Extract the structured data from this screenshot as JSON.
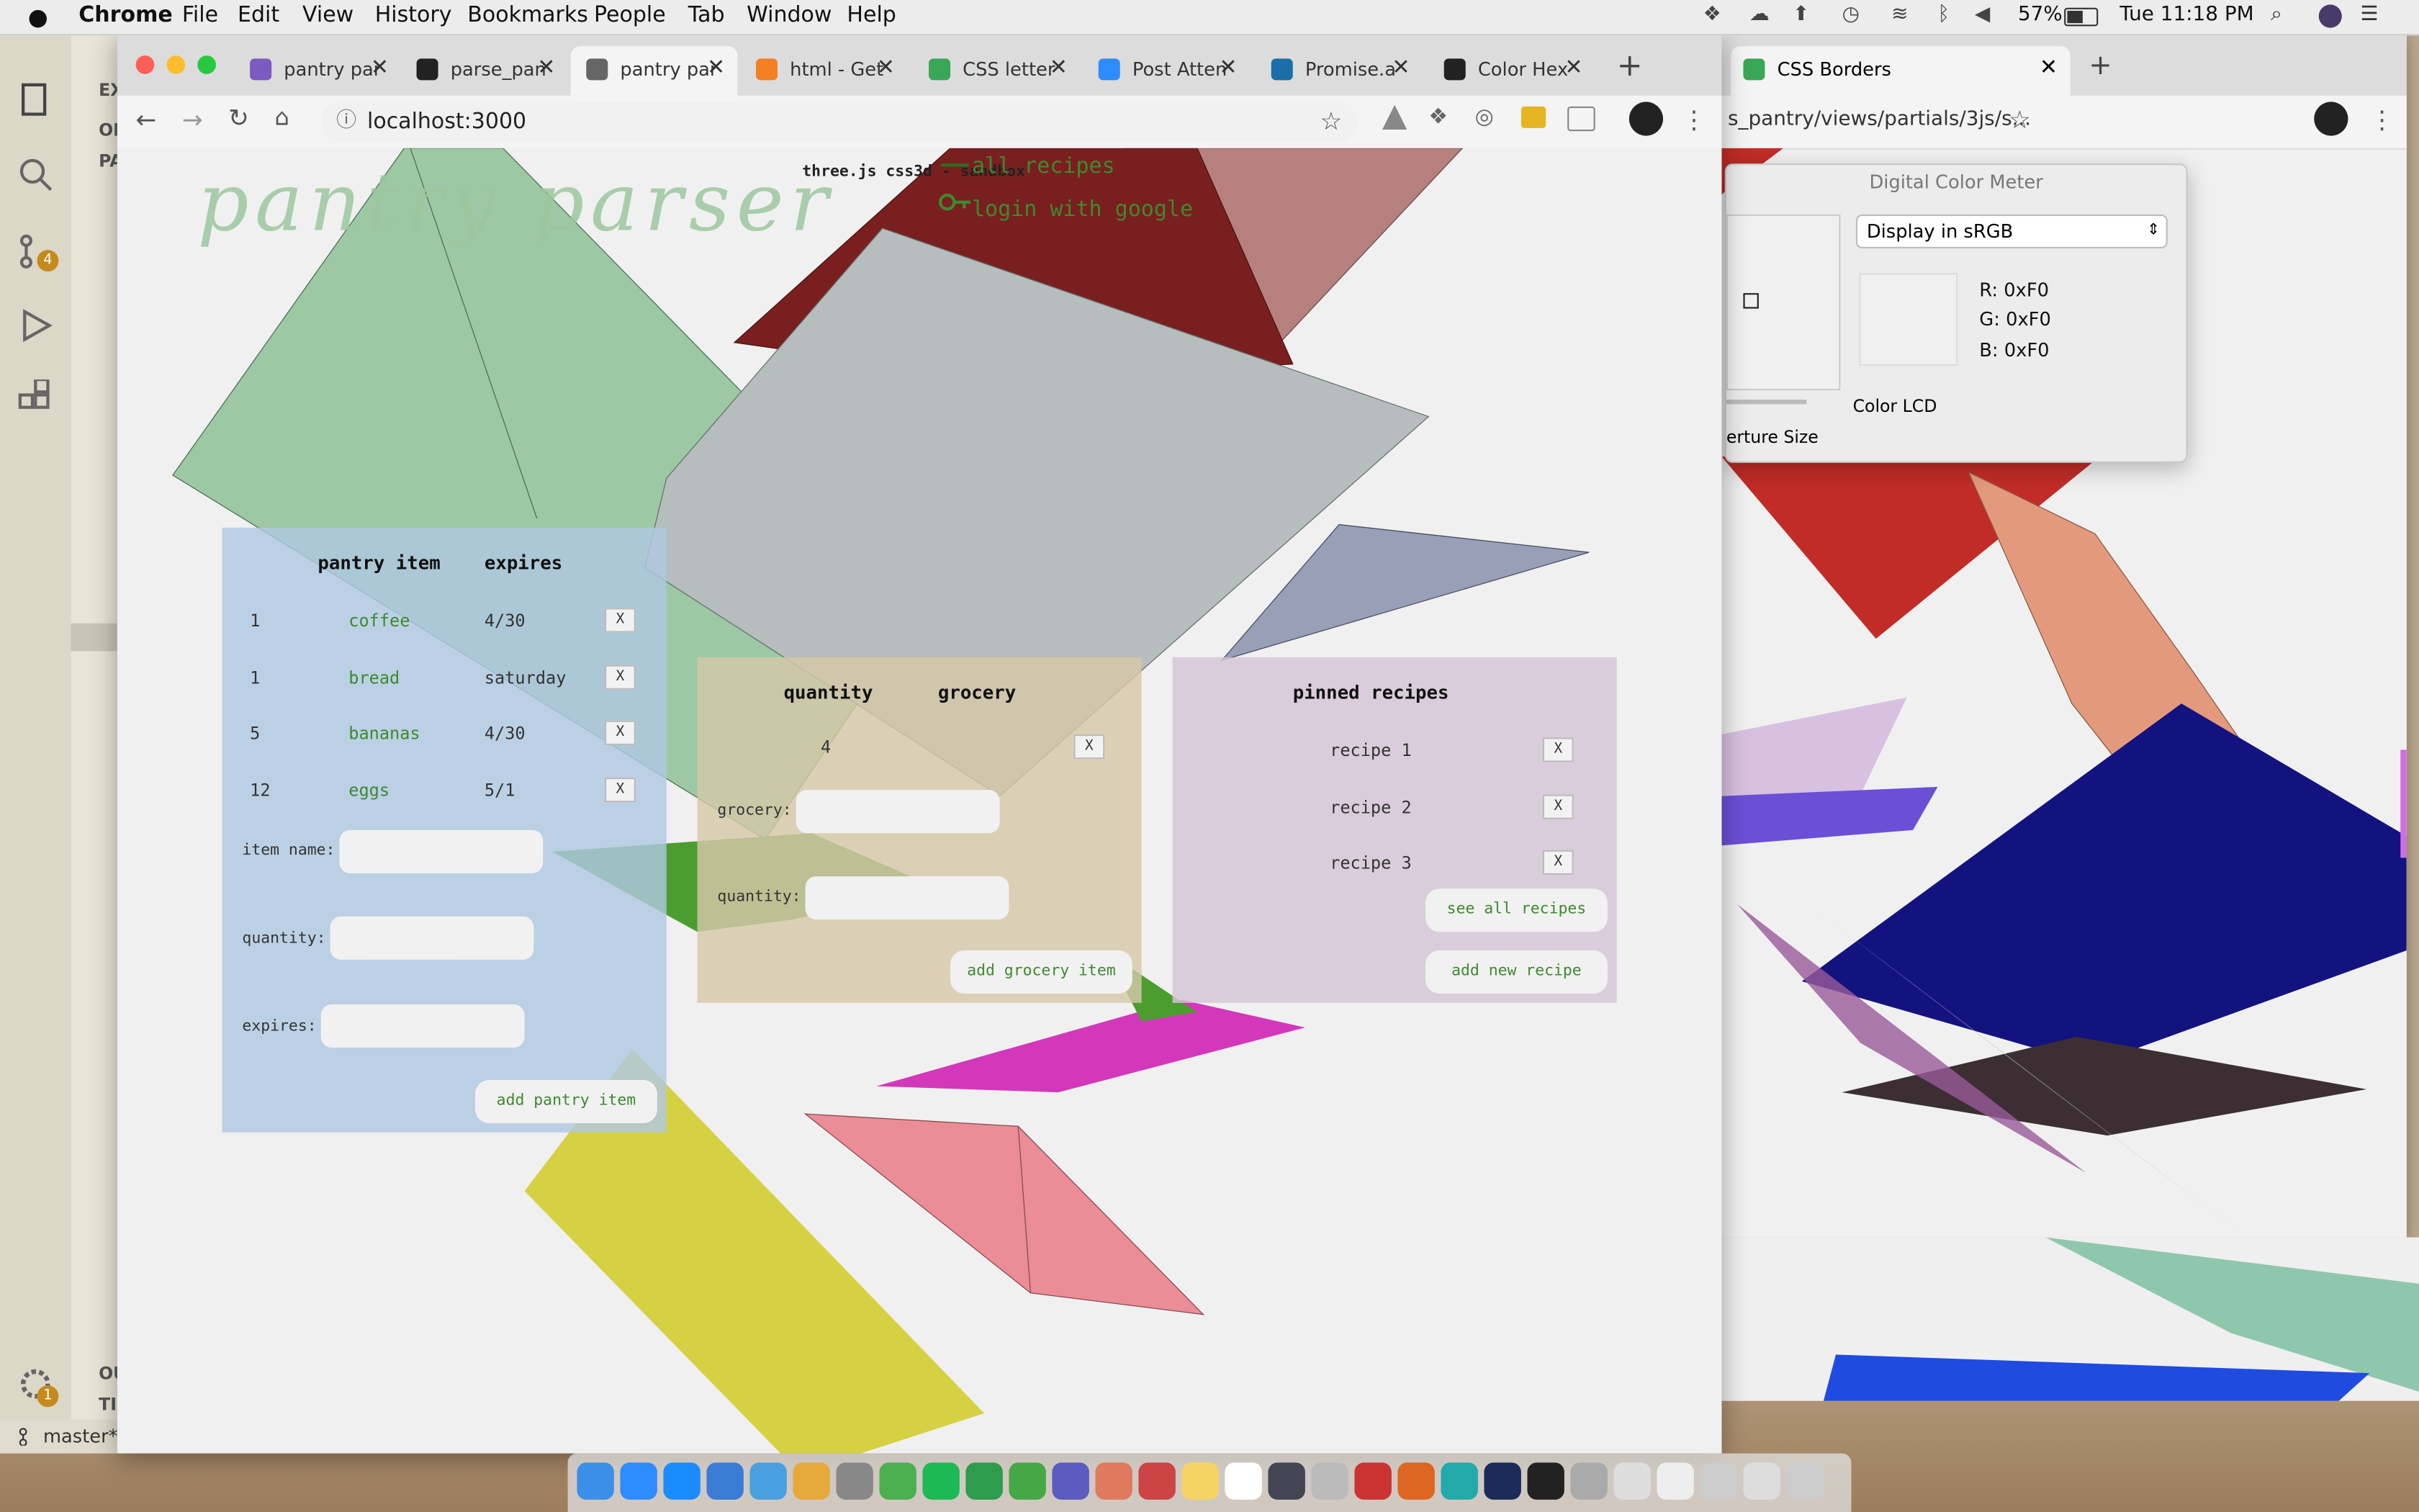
{
  "menubar": {
    "apple": "",
    "app": "Chrome",
    "items": [
      "File",
      "Edit",
      "View",
      "History",
      "Bookmarks",
      "People",
      "Tab",
      "Window",
      "Help"
    ],
    "battery": "57%",
    "clock": "Tue 11:18 PM"
  },
  "vscode": {
    "section_labels": [
      "EX",
      "OF",
      "PA",
      "OU",
      "TI"
    ],
    "branch": "master*",
    "badges": [
      "4",
      "1"
    ]
  },
  "chrome_main": {
    "tabs": [
      {
        "label": "pantry par",
        "icon_color": "#7a5bbf"
      },
      {
        "label": "parse_pan",
        "icon_color": "#222222"
      },
      {
        "label": "pantry par",
        "icon_color": "#666666",
        "active": true
      },
      {
        "label": "html - Get",
        "icon_color": "#f48024"
      },
      {
        "label": "CSS letter",
        "icon_color": "#3aa757"
      },
      {
        "label": "Post Atten",
        "icon_color": "#2d8cff"
      },
      {
        "label": "Promise.a",
        "icon_color": "#1b6ea8"
      },
      {
        "label": "Color Hex",
        "icon_color": "#222222"
      }
    ],
    "url": "localhost:3000"
  },
  "chrome_secondary": {
    "tab_label": "CSS Borders",
    "url": "s_pantry/views/partials/3js/s..."
  },
  "color_meter": {
    "title": "Digital Color Meter",
    "mode": "Display in sRGB",
    "r": "0xF0",
    "g": "0xF0",
    "b": "0xF0",
    "r_label": "R:",
    "g_label": "G:",
    "b_label": "B:",
    "display": "Color LCD",
    "aperture": "erture Size"
  },
  "app": {
    "logo": "pantry parser",
    "header_text": "three.js css3d - sandbox",
    "nav": {
      "all_recipes": "all recipes",
      "login": "login with google"
    },
    "pantry": {
      "col_item": "pantry item",
      "col_expires": "expires",
      "rows": [
        {
          "qty": "1",
          "item": "coffee",
          "expires": "4/30"
        },
        {
          "qty": "1",
          "item": "bread",
          "expires": "saturday"
        },
        {
          "qty": "5",
          "item": "bananas",
          "expires": "4/30"
        },
        {
          "qty": "12",
          "item": "eggs",
          "expires": "5/1"
        }
      ],
      "remove_label": "X",
      "item_name_label": "item name:",
      "quantity_label": "quantity:",
      "expires_label": "expires:",
      "add_button": "add pantry item"
    },
    "grocery": {
      "col_qty": "quantity",
      "col_grocery": "grocery",
      "rows": [
        {
          "qty": "4",
          "item": ""
        }
      ],
      "remove_label": "X",
      "grocery_label": "grocery:",
      "quantity_label": "quantity:",
      "add_button": "add grocery item"
    },
    "recipes": {
      "title": "pinned recipes",
      "items": [
        "recipe 1",
        "recipe 2",
        "recipe 3"
      ],
      "remove_label": "X",
      "see_all": "see all recipes",
      "add_new": "add new recipe"
    }
  }
}
